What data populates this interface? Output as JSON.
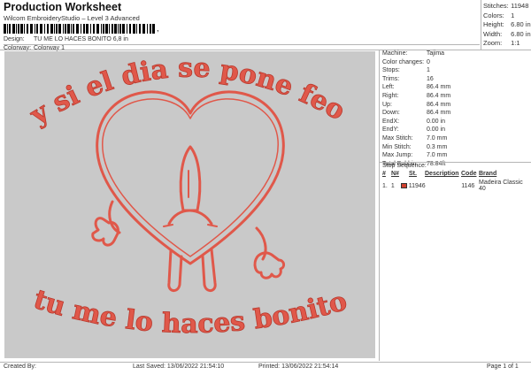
{
  "header": {
    "title": "Production Worksheet",
    "subtitle": "Wilcom EmbroideryStudio – Level 3 Advanced",
    "barcode_tail": ","
  },
  "info": {
    "design_label": "Design:",
    "design_value": "TU ME LO HACES BONITO 6,8 in",
    "colorway_label": "Colorway:",
    "colorway_value": "Colorway 1"
  },
  "stats": [
    {
      "label": "Stitches:",
      "value": "11948"
    },
    {
      "label": "Colors:",
      "value": "1"
    },
    {
      "label": "Height:",
      "value": "6.80 in"
    },
    {
      "label": "Width:",
      "value": "6.80 in"
    },
    {
      "label": "Zoom:",
      "value": "1:1"
    }
  ],
  "design": {
    "top_text": "y si el dia se pone feo",
    "bottom_text": "tu me lo haces bonito",
    "thread_color": "#e0584a",
    "background_color": "#c9c9c9"
  },
  "specs": [
    {
      "label": "Machine:",
      "value": "Tajima"
    },
    {
      "label": "Color changes:",
      "value": "0"
    },
    {
      "label": "Stops:",
      "value": "1"
    },
    {
      "label": "Trims:",
      "value": "16"
    },
    {
      "label": "Left:",
      "value": "86.4 mm"
    },
    {
      "label": "Right:",
      "value": "86.4 mm"
    },
    {
      "label": "Up:",
      "value": "86.4 mm"
    },
    {
      "label": "Down:",
      "value": "86.4 mm"
    },
    {
      "label": "EndX:",
      "value": "0.00 in"
    },
    {
      "label": "EndY:",
      "value": "0.00 in"
    },
    {
      "label": "Max Stitch:",
      "value": "7.0 mm"
    },
    {
      "label": "Min Stitch:",
      "value": "0.3 mm"
    },
    {
      "label": "Max Jump:",
      "value": "7.0 mm"
    },
    {
      "label": "Total Bobbin:",
      "value": "78.84ft"
    }
  ],
  "sequence": {
    "label": "Stop Sequence:",
    "columns": [
      "#",
      "N#",
      "St.",
      "Description",
      "Code",
      "Brand"
    ],
    "rows": [
      {
        "num": "1.",
        "n": "1",
        "stitches": "11946",
        "description": "",
        "code": "1146",
        "brand": "Madeira Classic 40",
        "color": "#d0402f"
      }
    ]
  },
  "footer": {
    "created_by": "Created By:",
    "last_saved": "Last Saved: 13/06/2022 21:54:10",
    "printed": "Printed: 13/06/2022 21:54:14",
    "page": "Page 1 of 1"
  }
}
